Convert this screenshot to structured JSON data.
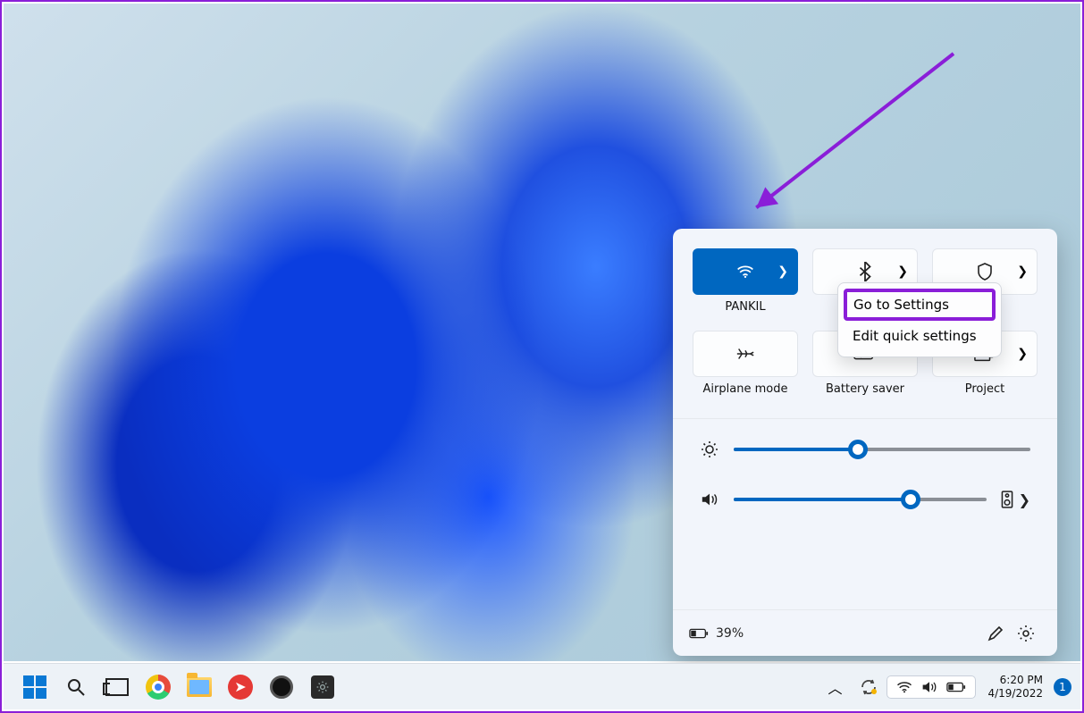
{
  "quick_settings": {
    "tiles": [
      {
        "id": "wifi",
        "label": "PANKIL",
        "active": true,
        "has_chevron": true
      },
      {
        "id": "bluetooth",
        "label": "",
        "active": false,
        "has_chevron": true
      },
      {
        "id": "security",
        "label": "",
        "active": false,
        "has_chevron": true
      },
      {
        "id": "airplane",
        "label": "Airplane mode",
        "active": false,
        "has_chevron": false
      },
      {
        "id": "battery_saver",
        "label": "Battery saver",
        "active": false,
        "has_chevron": false
      },
      {
        "id": "project",
        "label": "Project",
        "active": false,
        "has_chevron": true
      }
    ],
    "context_menu": {
      "items": [
        "Go to Settings",
        "Edit quick settings"
      ],
      "highlighted_index": 0
    },
    "brightness_percent": 42,
    "volume_percent": 70,
    "battery_text": "39%"
  },
  "taskbar": {
    "apps": [
      "start",
      "search",
      "task-view",
      "chrome",
      "file-explorer",
      "send-anywhere",
      "obs",
      "settings"
    ],
    "tray": {
      "overflow": "^",
      "onedrive_sync": true,
      "wifi": true,
      "volume": true,
      "battery": true
    },
    "clock": {
      "time": "6:20 PM",
      "date": "4/19/2022"
    },
    "notification_count": "1"
  },
  "annotation": {
    "arrow_color": "#8a1ed8"
  }
}
